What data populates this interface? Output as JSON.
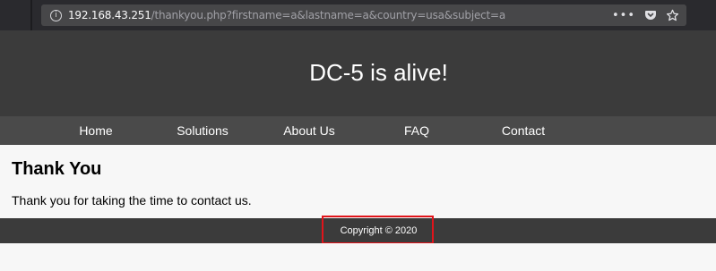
{
  "browser": {
    "url_host": "192.168.43.251",
    "url_path": "/thankyou.php?firstname=a&lastname=a&country=usa&subject=a",
    "icons": {
      "info": "info-icon",
      "menu": "more-dots-icon",
      "pocket": "pocket-icon",
      "bookmark": "star-icon"
    }
  },
  "header": {
    "title": "DC-5 is alive!"
  },
  "nav": {
    "items": [
      {
        "label": "Home"
      },
      {
        "label": "Solutions"
      },
      {
        "label": "About Us"
      },
      {
        "label": "FAQ"
      },
      {
        "label": "Contact"
      }
    ]
  },
  "content": {
    "heading": "Thank You",
    "message": "Thank you for taking the time to contact us."
  },
  "footer": {
    "copyright": "Copyright © 2020"
  },
  "colors": {
    "header_bg": "#3b3b3b",
    "nav_bg": "#4a4a4a",
    "page_bg": "#f7f7f7",
    "highlight": "#e0141b"
  }
}
